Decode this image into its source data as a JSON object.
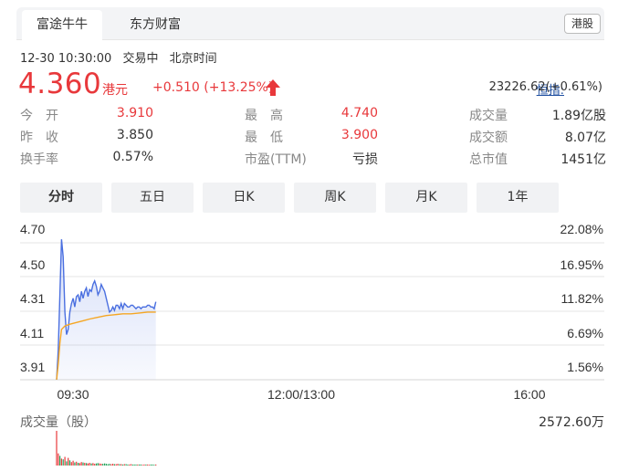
{
  "tabs": [
    {
      "label": "富途牛牛",
      "active": true
    },
    {
      "label": "东方财富",
      "active": false
    }
  ],
  "market_badge": "港股",
  "time_row": {
    "datetime": "12-30 10:30:00",
    "status": "交易中",
    "timezone": "北京时间"
  },
  "price": {
    "value": "4.360",
    "unit": "港元",
    "change": "+0.510 (+13.25%)",
    "direction": "up",
    "color": "#e8383b"
  },
  "index": {
    "label": "恒指:",
    "value": "23226.62(+0.61%)"
  },
  "stats": [
    [
      {
        "label": "今　开",
        "value": "3.910",
        "tone": "red"
      },
      {
        "label": "最　高",
        "value": "4.740",
        "tone": "red"
      },
      {
        "label": "成交量",
        "value": "1.89亿股",
        "tone": "dark"
      }
    ],
    [
      {
        "label": "昨　收",
        "value": "3.850",
        "tone": "dark"
      },
      {
        "label": "最　低",
        "value": "3.900",
        "tone": "red"
      },
      {
        "label": "成交额",
        "value": "8.07亿",
        "tone": "dark"
      }
    ],
    [
      {
        "label": "换手率",
        "value": "0.57%",
        "tone": "dark"
      },
      {
        "label": "市盈(TTM)",
        "value": "亏损",
        "tone": "dark"
      },
      {
        "label": "总市值",
        "value": "1451亿",
        "tone": "dark"
      }
    ]
  ],
  "period_tabs": [
    {
      "label": "分时",
      "active": true
    },
    {
      "label": "五日",
      "active": false
    },
    {
      "label": "日K",
      "active": false
    },
    {
      "label": "周K",
      "active": false
    },
    {
      "label": "月K",
      "active": false
    },
    {
      "label": "1年",
      "active": false
    }
  ],
  "chart_data": {
    "type": "line",
    "y_left_ticks": [
      "4.70",
      "4.50",
      "4.31",
      "4.11",
      "3.91"
    ],
    "y_right_ticks": [
      "22.08%",
      "16.95%",
      "11.82%",
      "6.69%",
      "1.56%"
    ],
    "x_ticks": [
      "09:30",
      "12:00/13:00",
      "16:00"
    ],
    "ylim": [
      3.91,
      4.7
    ],
    "session_minutes": 330,
    "price_color": "#4a6fe0",
    "avg_color": "#f5a623",
    "volume_color_up": "#e8383b",
    "volume_color_down": "#22a35a",
    "series": [
      {
        "minutes": [
          0,
          1,
          2,
          3,
          4,
          5,
          6,
          7,
          8,
          9,
          10,
          11,
          12,
          13,
          14,
          15,
          16,
          17,
          18,
          19,
          20,
          21,
          22,
          23,
          24,
          25,
          26,
          27,
          28,
          29,
          30,
          31,
          32,
          33,
          34,
          35,
          36,
          37,
          38,
          39,
          40,
          41,
          42,
          43,
          44,
          45,
          46,
          47,
          48,
          49,
          50,
          51,
          52,
          53,
          54,
          55,
          56,
          57,
          58,
          59,
          60
        ],
        "values": [
          3.91,
          4.08,
          4.4,
          4.72,
          4.62,
          4.3,
          4.17,
          4.2,
          4.3,
          4.35,
          4.38,
          4.33,
          4.39,
          4.4,
          4.36,
          4.42,
          4.38,
          4.42,
          4.44,
          4.39,
          4.43,
          4.42,
          4.46,
          4.48,
          4.45,
          4.4,
          4.42,
          4.46,
          4.44,
          4.42,
          4.38,
          4.34,
          4.3,
          4.31,
          4.33,
          4.31,
          4.34,
          4.34,
          4.32,
          4.35,
          4.32,
          4.35,
          4.34,
          4.33,
          4.33,
          4.34,
          4.34,
          4.33,
          4.32,
          4.33,
          4.33,
          4.32,
          4.33,
          4.33,
          4.33,
          4.34,
          4.34,
          4.33,
          4.33,
          4.32,
          4.36
        ]
      },
      {
        "minutes": [
          0,
          1,
          2,
          3,
          5,
          8,
          12,
          16,
          20,
          25,
          30,
          35,
          40,
          45,
          50,
          55,
          60
        ],
        "values": [
          3.91,
          4.0,
          4.12,
          4.2,
          4.22,
          4.23,
          4.24,
          4.25,
          4.26,
          4.27,
          4.28,
          4.285,
          4.29,
          4.29,
          4.295,
          4.3,
          4.3
        ]
      }
    ],
    "volume": [
      100,
      35,
      28,
      20,
      18,
      25,
      12,
      22,
      15,
      10,
      14,
      9,
      11,
      8,
      7,
      10,
      9,
      8,
      7,
      6,
      8,
      6,
      7,
      5,
      6,
      7,
      6,
      5,
      5,
      6,
      5,
      4,
      5,
      4,
      5,
      4,
      4,
      5,
      4,
      4,
      3,
      4,
      4,
      3,
      3,
      4,
      3,
      3,
      3,
      3,
      3,
      3,
      2,
      3,
      3,
      3,
      2,
      3,
      3,
      2,
      3
    ],
    "volume_up": [
      true,
      true,
      false,
      true,
      false,
      true,
      false,
      true,
      false,
      true,
      true,
      false,
      true,
      false,
      true,
      true,
      false,
      true,
      false,
      true,
      true,
      false,
      true,
      true,
      false,
      false,
      true,
      true,
      false,
      false,
      false,
      false,
      false,
      true,
      true,
      false,
      true,
      true,
      false,
      true,
      false,
      true,
      false,
      false,
      true,
      true,
      false,
      false,
      false,
      true,
      false,
      false,
      true,
      true,
      false,
      true,
      true,
      false,
      false,
      false,
      true
    ],
    "volume_label": "成交量（股）",
    "volume_max": "2572.60万"
  }
}
